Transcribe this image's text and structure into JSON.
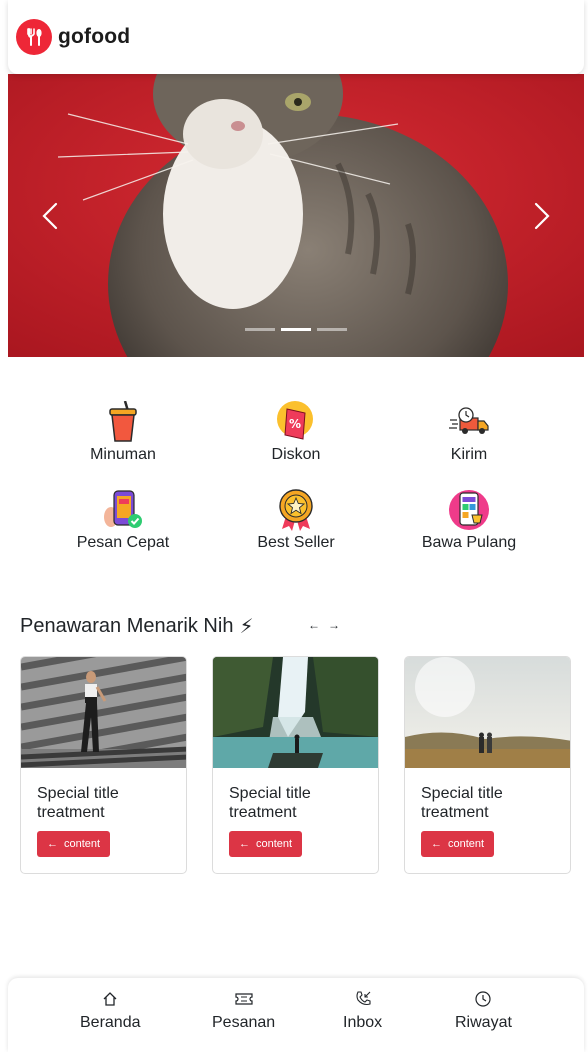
{
  "header": {
    "brand": "gofood",
    "logo_icon": "fork-spoon-icon"
  },
  "carousel": {
    "image": "kitten-photo",
    "prev_icon": "chevron-left-icon",
    "next_icon": "chevron-right-icon",
    "slide_count": 3,
    "active_index": 1
  },
  "categories": [
    {
      "label": "Minuman",
      "icon": "drink-cup-icon"
    },
    {
      "label": "Diskon",
      "icon": "discount-tag-icon"
    },
    {
      "label": "Kirim",
      "icon": "delivery-truck-icon"
    },
    {
      "label": "Pesan Cepat",
      "icon": "phone-order-icon"
    },
    {
      "label": "Best Seller",
      "icon": "medal-icon"
    },
    {
      "label": "Bawa Pulang",
      "icon": "shopping-app-icon"
    }
  ],
  "offers": {
    "title": "Penawaran Menarik Nih",
    "emoji": "⚡",
    "prev_symbol": "←",
    "next_symbol": "→",
    "cards": [
      {
        "title": "Special title treatment",
        "button": "content",
        "image": "person-striped-shadow-photo"
      },
      {
        "title": "Special title treatment",
        "button": "content",
        "image": "waterfall-photo"
      },
      {
        "title": "Special title treatment",
        "button": "content",
        "image": "couple-field-photo"
      }
    ]
  },
  "bottom_nav": [
    {
      "label": "Beranda",
      "icon": "home-icon"
    },
    {
      "label": "Pesanan",
      "icon": "ticket-icon"
    },
    {
      "label": "Inbox",
      "icon": "phone-incoming-icon"
    },
    {
      "label": "Riwayat",
      "icon": "clock-icon"
    }
  ],
  "colors": {
    "brand": "#ee2737",
    "button": "#dc3545"
  }
}
